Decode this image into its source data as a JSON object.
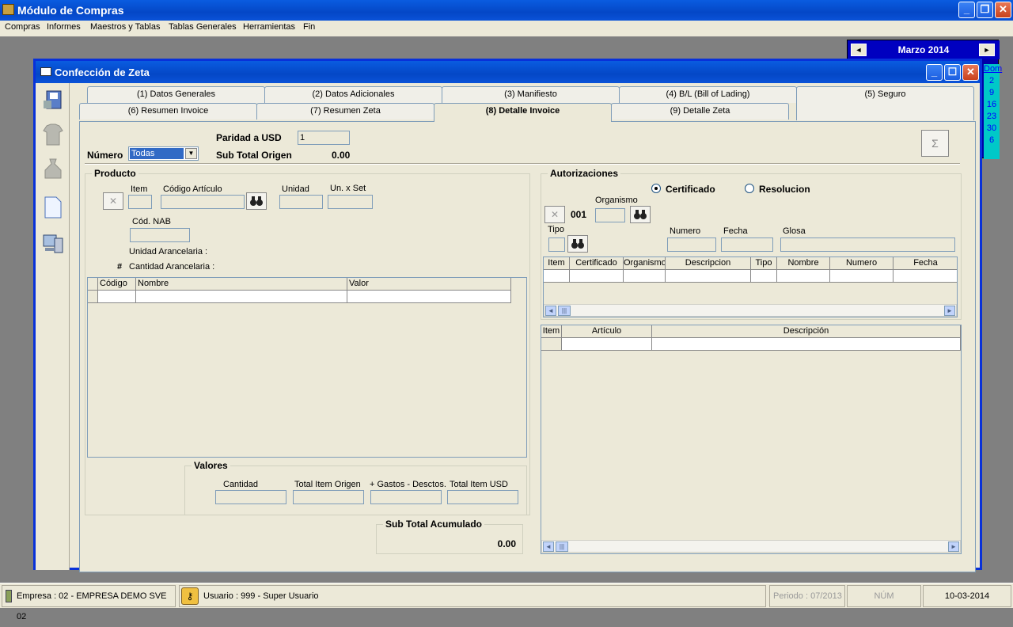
{
  "app": {
    "title": "Módulo de Compras"
  },
  "menu": [
    "Compras",
    "Informes",
    "Maestros y Tablas",
    "Tablas Generales",
    "Herramientas",
    "Fin"
  ],
  "calendar": {
    "month": "Marzo 2014",
    "day_header": "Dom",
    "days": [
      "2",
      "9",
      "16",
      "23",
      "30",
      "6"
    ]
  },
  "window": {
    "title": "Confección de Zeta"
  },
  "tabs_row1": [
    "(1) Datos Generales",
    "(2) Datos Adicionales",
    "(3) Manifiesto",
    "(4) B/L (Bill of Lading)",
    "(5) Seguro"
  ],
  "tabs_row2": [
    "(6) Resumen Invoice",
    "(7) Resumen Zeta",
    "(8) Detalle Invoice",
    "(9) Detalle Zeta"
  ],
  "header": {
    "paridad_label": "Paridad a USD",
    "paridad_value": "1",
    "numero_label": "Número",
    "numero_value": "Todas",
    "subtotal_label": "Sub Total Origen",
    "subtotal_value": "0.00",
    "sigma": "Σ"
  },
  "producto": {
    "legend": "Producto",
    "item_label": "Item",
    "codigo_label": "Código Artículo",
    "unidad_label": "Unidad",
    "unxset_label": "Un. x Set",
    "nab_label": "Cód. NAB",
    "unidad_arancelaria": "Unidad Arancelaria :",
    "hash": "#",
    "cantidad_arancelaria": "Cantidad Arancelaria :",
    "grid_columns": [
      "Código",
      "Nombre",
      "Valor"
    ]
  },
  "valores": {
    "legend": "Valores",
    "columns": [
      "Cantidad",
      "Total Item Origen",
      "+ Gastos - Desctos.",
      "Total Item USD"
    ]
  },
  "subtotal_acumulado": {
    "legend": "Sub Total Acumulado",
    "value": "0.00"
  },
  "autorizaciones": {
    "legend": "Autorizaciones",
    "radio_certificado": "Certificado",
    "radio_resolucion": "Resolucion",
    "selected": "Certificado",
    "organismo_label": "Organismo",
    "code": "001",
    "tipo_label": "Tipo",
    "numero_label": "Numero",
    "fecha_label": "Fecha",
    "glosa_label": "Glosa",
    "grid_columns": [
      "Item",
      "Certificado",
      "Organismo",
      "Descripcion",
      "Tipo",
      "Nombre",
      "Numero",
      "Fecha"
    ]
  },
  "articulos": {
    "grid_columns": [
      "Item",
      "Artículo",
      "Descripción"
    ]
  },
  "status": {
    "empresa": "Empresa : 02 - EMPRESA DEMO SVE 02",
    "usuario": "Usuario : 999 -  Super Usuario",
    "periodo": "Periodo : 07/2013",
    "num": "NÚM",
    "fecha": "10-03-2014"
  }
}
